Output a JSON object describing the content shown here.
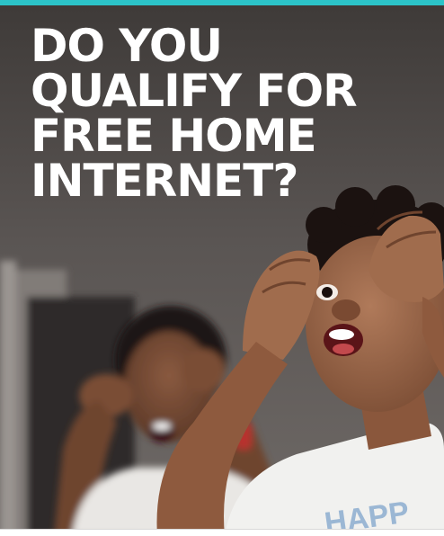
{
  "accent_color": "#2cc4c9",
  "headline": {
    "line1": "DO YOU",
    "line2": "QUALIFY FOR",
    "line3": "FREE HOME",
    "line4": "INTERNET?"
  },
  "shirt_print": "HAPP",
  "icons": [
    "hero-photo"
  ]
}
